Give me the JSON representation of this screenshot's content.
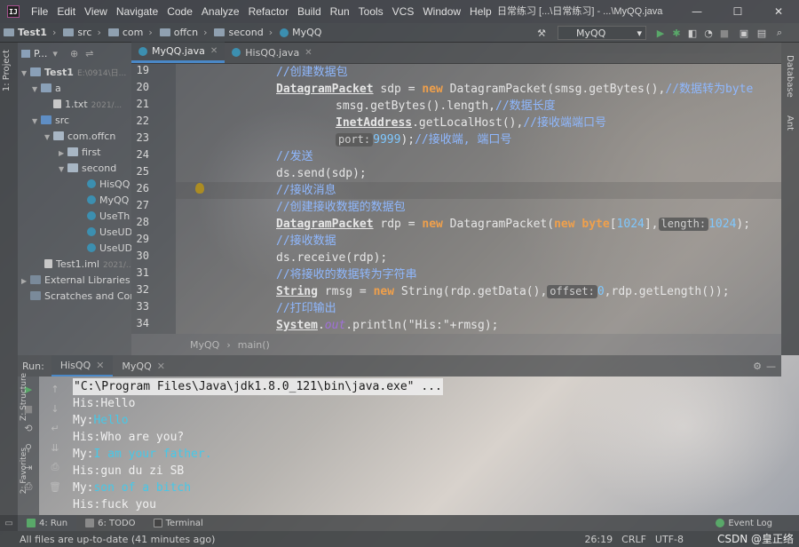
{
  "app": {
    "logo_text": "IJ",
    "window_title": "日常练习 [...\\日常练习] - ...\\MyQQ.java",
    "menu": [
      "File",
      "Edit",
      "View",
      "Navigate",
      "Code",
      "Analyze",
      "Refactor",
      "Build",
      "Run",
      "Tools",
      "VCS",
      "Window",
      "Help"
    ],
    "controls": {
      "minimize": "—",
      "maximize": "☐",
      "close": "✕"
    }
  },
  "navbar": {
    "crumbs": [
      "Test1",
      "src",
      "com",
      "offcn",
      "second",
      "MyQQ"
    ],
    "run_config": "MyQQ"
  },
  "project_panel": {
    "header": "P...",
    "side_tab": "1: Project",
    "tree": [
      {
        "label": "Test1",
        "meta": "E:\\0914\\日...",
        "icon": "folder",
        "arrow": "▼"
      },
      {
        "label": "a",
        "meta": "",
        "icon": "folder",
        "arrow": "▼"
      },
      {
        "label": "1.txt",
        "meta": "2021/...",
        "icon": "file",
        "arrow": ""
      },
      {
        "label": "src",
        "meta": "",
        "icon": "src",
        "arrow": "▼"
      },
      {
        "label": "com.offcn",
        "meta": "",
        "icon": "pkg",
        "arrow": "▼"
      },
      {
        "label": "first",
        "meta": "",
        "icon": "pkg",
        "arrow": "▶"
      },
      {
        "label": "second",
        "meta": "",
        "icon": "pkg",
        "arrow": "▼"
      },
      {
        "label": "HisQQ",
        "meta": "",
        "icon": "class",
        "arrow": ""
      },
      {
        "label": "MyQQ",
        "meta": "",
        "icon": "class",
        "arrow": ""
      },
      {
        "label": "UseTh",
        "meta": "",
        "icon": "class",
        "arrow": ""
      },
      {
        "label": "UseUD",
        "meta": "",
        "icon": "class",
        "arrow": ""
      },
      {
        "label": "UseUD",
        "meta": "",
        "icon": "class",
        "arrow": ""
      },
      {
        "label": "Test1.iml",
        "meta": "2021/...",
        "icon": "file",
        "arrow": ""
      },
      {
        "label": "External Libraries",
        "meta": "",
        "icon": "lib",
        "arrow": "▶"
      },
      {
        "label": "Scratches and Con",
        "meta": "",
        "icon": "lib",
        "arrow": ""
      }
    ]
  },
  "right_strip": {
    "tabs": [
      "Database",
      "Ant"
    ]
  },
  "editor": {
    "tabs": [
      {
        "label": "MyQQ.java",
        "active": true
      },
      {
        "label": "HisQQ.java",
        "active": false
      }
    ],
    "line_numbers": [
      "19",
      "20",
      "21",
      "22",
      "23",
      "24",
      "25",
      "26",
      "27",
      "28",
      "29",
      "30",
      "31",
      "32",
      "33",
      "34"
    ],
    "lines": {
      "l19_cmt": "//创建数据包",
      "l20_type": "DatagramPacket",
      "l20_a": " sdp = ",
      "l20_kw": "new",
      "l20_b": " DatagramPacket(smsg.getBytes(),",
      "l20_cmt": "//数据转为byte",
      "l21": "smsg.getBytes().length,",
      "l21_cmt": "//数据长度",
      "l22_type": "InetAddress",
      "l22_a": ".getLocalHost(),",
      "l22_cmt": "//接收端端口号",
      "l23_hint": "port:",
      "l23_num": "9999",
      "l23_a": ");",
      "l23_cmt": "//接收端, 端口号",
      "l24_cmt": "//发送",
      "l25": "ds.send(sdp);",
      "l26_cmt": "//接收消息",
      "l27_cmt": "//创建接收数据的数据包",
      "l28_type": "DatagramPacket",
      "l28_a": " rdp = ",
      "l28_kw1": "new",
      "l28_b": " DatagramPacket(",
      "l28_kw2": "new byte",
      "l28_c": "[",
      "l28_num1": "1024",
      "l28_d": "],",
      "l28_hint": "length:",
      "l28_num2": "1024",
      "l28_e": ");",
      "l29_cmt": "//接收数据",
      "l30": "ds.receive(rdp);",
      "l31_cmt": "//将接收的数据转为字符串",
      "l32_type": "String",
      "l32_a": " rmsg = ",
      "l32_kw": "new",
      "l32_b": " String(rdp.getData(),",
      "l32_hint": "offset:",
      "l32_num": "0",
      "l32_c": ",rdp.getLength());",
      "l33_cmt": "//打印输出",
      "l34_type": "System",
      "l34_a": ".",
      "l34_fld": "out",
      "l34_b": ".println(\"His:\"+rmsg);"
    },
    "breadcrumb": [
      "MyQQ",
      "main()"
    ]
  },
  "run_panel": {
    "label": "Run:",
    "tabs": [
      {
        "label": "HisQQ",
        "active": true
      },
      {
        "label": "MyQQ",
        "active": false
      }
    ],
    "console": [
      {
        "text": "\"C:\\Program Files\\Java\\jdk1.8.0_121\\bin\\java.exe\" ...",
        "prefix": "",
        "kind": "cmd"
      },
      {
        "prefix": "His:",
        "text": "Hello",
        "kind": "out"
      },
      {
        "prefix": "My:",
        "text": "Hello",
        "kind": "in"
      },
      {
        "prefix": "His:",
        "text": "Who are you?",
        "kind": "out"
      },
      {
        "prefix": "My:",
        "text": "I am your father.",
        "kind": "in"
      },
      {
        "prefix": "His:",
        "text": "gun du zi SB",
        "kind": "out"
      },
      {
        "prefix": "My:",
        "text": "son of a bitch",
        "kind": "in"
      },
      {
        "prefix": "His:",
        "text": "fuck you",
        "kind": "out"
      }
    ],
    "side_tabs": [
      "Z: Structure",
      "2: Favorites"
    ]
  },
  "bottom_tabs": [
    {
      "label": "4: Run",
      "active": true
    },
    {
      "label": "6: TODO",
      "active": false
    },
    {
      "label": "Terminal",
      "active": false
    }
  ],
  "event_log": "Event Log",
  "status": {
    "message": "All files are up-to-date (41 minutes ago)",
    "position": "26:19",
    "line_sep": "CRLF",
    "encoding": "UTF-8",
    "watermark": "CSDN @皇正络"
  }
}
